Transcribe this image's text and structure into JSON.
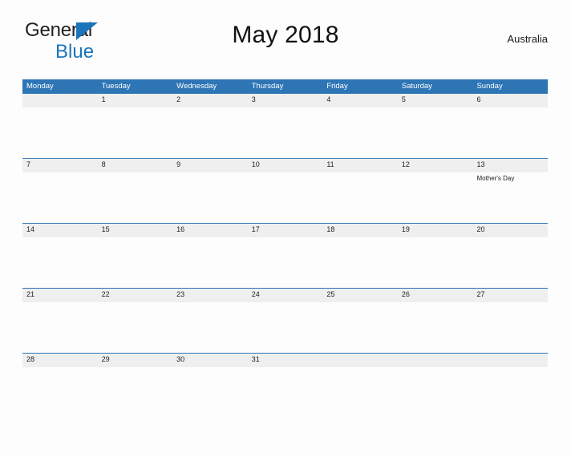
{
  "brand": {
    "name_part1": "General",
    "name_part2": "Blue",
    "flag_icon": "triangle-flag-icon",
    "color_primary": "#1B75BB",
    "color_text": "#231F20"
  },
  "header": {
    "title": "May 2018",
    "region": "Australia"
  },
  "calendar": {
    "accent_color": "#2E75B6",
    "band_color": "#EFEFEF",
    "weekday_headers": [
      "Monday",
      "Tuesday",
      "Wednesday",
      "Thursday",
      "Friday",
      "Saturday",
      "Sunday"
    ],
    "weeks": [
      {
        "days": [
          {
            "date": "",
            "events": []
          },
          {
            "date": "1",
            "events": []
          },
          {
            "date": "2",
            "events": []
          },
          {
            "date": "3",
            "events": []
          },
          {
            "date": "4",
            "events": []
          },
          {
            "date": "5",
            "events": []
          },
          {
            "date": "6",
            "events": []
          }
        ]
      },
      {
        "days": [
          {
            "date": "7",
            "events": []
          },
          {
            "date": "8",
            "events": []
          },
          {
            "date": "9",
            "events": []
          },
          {
            "date": "10",
            "events": []
          },
          {
            "date": "11",
            "events": []
          },
          {
            "date": "12",
            "events": []
          },
          {
            "date": "13",
            "events": [
              "Mother's Day"
            ]
          }
        ]
      },
      {
        "days": [
          {
            "date": "14",
            "events": []
          },
          {
            "date": "15",
            "events": []
          },
          {
            "date": "16",
            "events": []
          },
          {
            "date": "17",
            "events": []
          },
          {
            "date": "18",
            "events": []
          },
          {
            "date": "19",
            "events": []
          },
          {
            "date": "20",
            "events": []
          }
        ]
      },
      {
        "days": [
          {
            "date": "21",
            "events": []
          },
          {
            "date": "22",
            "events": []
          },
          {
            "date": "23",
            "events": []
          },
          {
            "date": "24",
            "events": []
          },
          {
            "date": "25",
            "events": []
          },
          {
            "date": "26",
            "events": []
          },
          {
            "date": "27",
            "events": []
          }
        ]
      },
      {
        "days": [
          {
            "date": "28",
            "events": []
          },
          {
            "date": "29",
            "events": []
          },
          {
            "date": "30",
            "events": []
          },
          {
            "date": "31",
            "events": []
          },
          {
            "date": "",
            "events": []
          },
          {
            "date": "",
            "events": []
          },
          {
            "date": "",
            "events": []
          }
        ]
      }
    ]
  }
}
